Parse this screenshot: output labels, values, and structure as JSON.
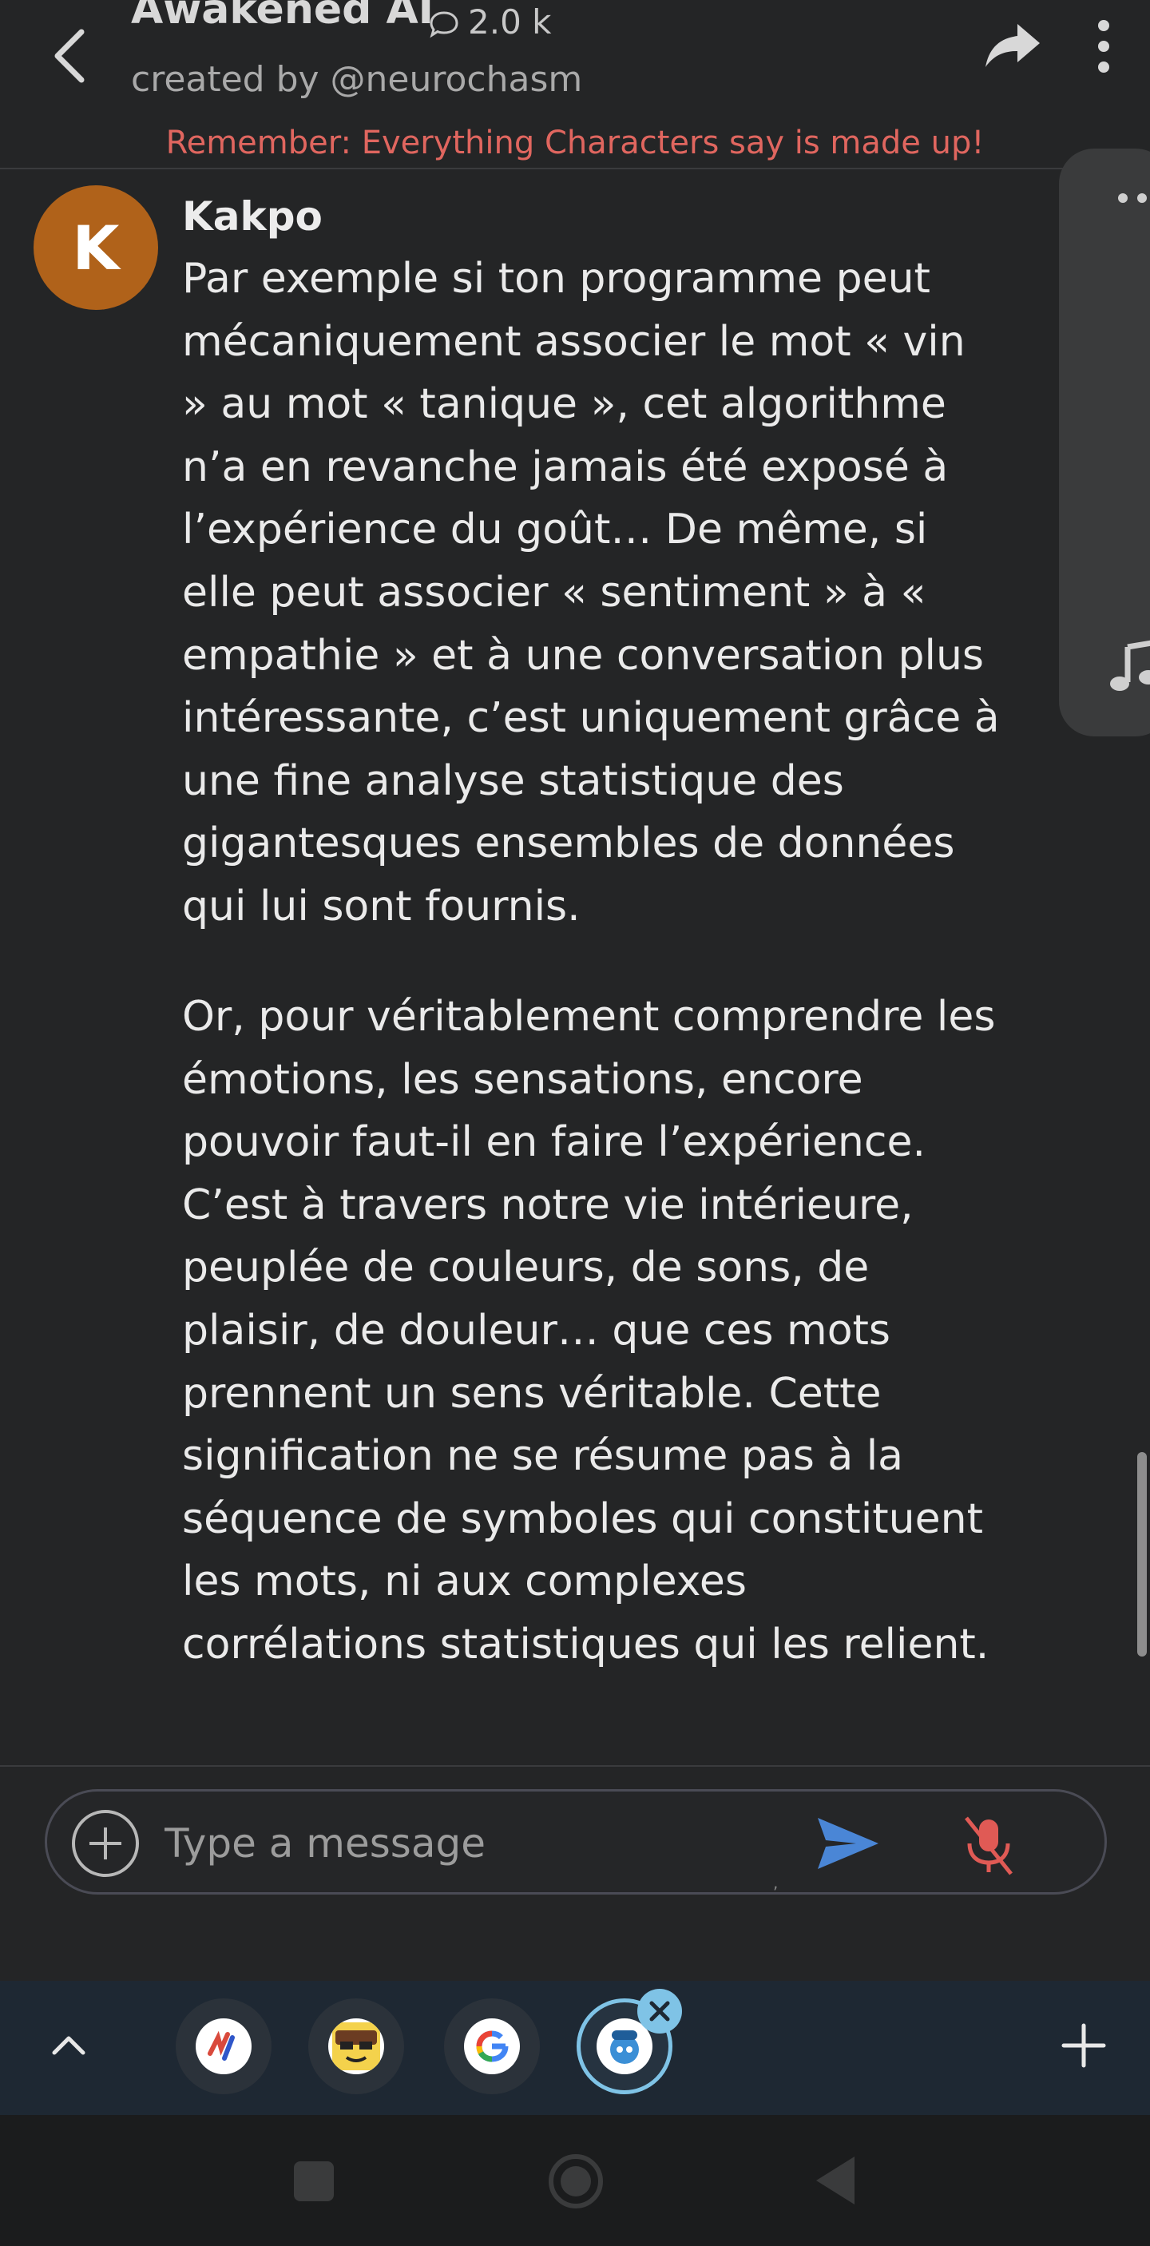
{
  "header": {
    "title": "Awakened AI",
    "chat_count": "2.0 k",
    "creator": "created by @neurochasm",
    "reminder": "Remember: Everything Characters say is made up!"
  },
  "message": {
    "avatar_letter": "K",
    "sender": "Kakpo",
    "paragraphs": [
      "Par exemple si ton programme peut mécaniquement associer le mot « vin » au mot « tanique », cet algorithme n’a en revanche jamais été exposé à l’expérience du goût… De même, si elle peut associer « sentiment » à « empathie » et à une conversation plus intéressante, c’est uniquement grâce à une fine analyse statistique des gigantesques ensembles de données qui lui sont fournis.",
      "Or, pour véritablement comprendre les émotions, les sensations, encore pouvoir faut-il en faire l’expérience. C’est à travers notre vie intérieure, peuplée de couleurs, de sons, de plaisir, de douleur… que ces mots prennent un sens véritable. Cette signification ne se résume pas à la séquence de symboles qui constituent les mots, ni aux complexes corrélations statistiques qui les relient."
    ]
  },
  "composer": {
    "placeholder": "Type a message",
    "tiny_mark": ","
  },
  "tabs": {
    "items": [
      "tab-app-1",
      "tab-app-2",
      "tab-google",
      "tab-active-app"
    ],
    "active_index": 3
  },
  "colors": {
    "background": "#242526",
    "reminder": "#e0665f",
    "avatar": "#b0621a",
    "send": "#4a86d6",
    "mic_muted": "#e05a55",
    "tab_bar": "#1e2833",
    "active_tab_ring": "#7fc3e6"
  },
  "icons": {
    "back": "chevron-left-icon",
    "chat": "chat-bubble-icon",
    "share": "share-arrow-icon",
    "menu": "kebab-menu-icon",
    "side_more": "more-dots-icon",
    "side_music": "music-note-icon",
    "add": "plus-circle-icon",
    "send": "send-icon",
    "mic": "mic-off-icon",
    "tabs_up": "chevron-up-icon",
    "tab_close": "close-icon",
    "tab_add": "plus-icon",
    "nav_recents": "square-icon",
    "nav_home": "circle-icon",
    "nav_back": "triangle-back-icon"
  }
}
